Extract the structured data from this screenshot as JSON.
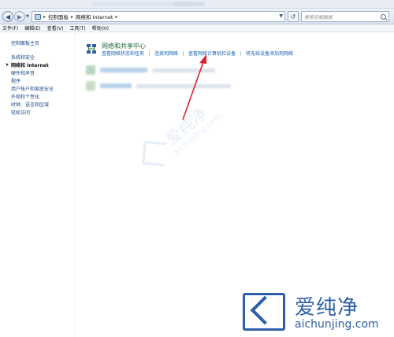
{
  "address_bar": {
    "crumbs": [
      "控制面板",
      "网络和 Internet"
    ],
    "search_placeholder": "搜索控制面板"
  },
  "menu": [
    "文件(F)",
    "编辑(E)",
    "查看(V)",
    "工具(T)",
    "帮助(H)"
  ],
  "sidebar": {
    "home": "控制面板主页",
    "items": [
      "系统和安全",
      "网络和 Internet",
      "硬件和声音",
      "程序",
      "用户帐户和家庭安全",
      "外观和个性化",
      "时钟、语言和区域",
      "轻松访问"
    ],
    "active_index": 1
  },
  "main": {
    "section_title": "网络和共享中心",
    "tasks": [
      "查看网络状态和任务",
      "连接到网络",
      "查看网络计算机和设备",
      "将无线设备添加到网络"
    ]
  },
  "watermark": {
    "zh": "爱纯净",
    "en": "aichunjing.com"
  },
  "colors": {
    "link": "#1a64b4",
    "title_green": "#1f6b3a",
    "annotation_red": "#d9262c",
    "watermark_blue": "#2d5fa8"
  },
  "icons": {
    "back": "arrow-left-icon",
    "forward": "arrow-right-icon",
    "refresh": "refresh-icon",
    "search": "search-icon",
    "network": "network-sharing-icon"
  }
}
